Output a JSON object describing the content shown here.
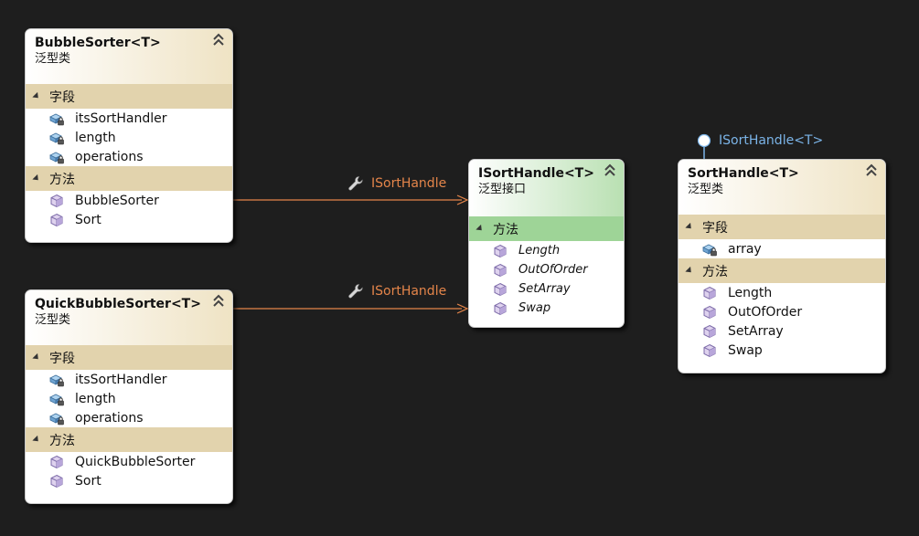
{
  "classes": {
    "bubble": {
      "title": "BubbleSorter<T>",
      "kind": "泛型类",
      "fields_label": "字段",
      "fields": [
        "itsSortHandler",
        "length",
        "operations"
      ],
      "methods_label": "方法",
      "methods": [
        "BubbleSorter",
        "Sort"
      ]
    },
    "quick": {
      "title": "QuickBubbleSorter<T>",
      "kind": "泛型类",
      "fields_label": "字段",
      "fields": [
        "itsSortHandler",
        "length",
        "operations"
      ],
      "methods_label": "方法",
      "methods": [
        "QuickBubbleSorter",
        "Sort"
      ]
    },
    "iface": {
      "title": "ISortHandle<T>",
      "kind": "泛型接口",
      "methods_label": "方法",
      "methods": [
        "Length",
        "OutOfOrder",
        "SetArray",
        "Swap"
      ]
    },
    "sorthandle": {
      "title": "SortHandle<T>",
      "kind": "泛型类",
      "fields_label": "字段",
      "fields": [
        "array"
      ],
      "methods_label": "方法",
      "methods": [
        "Length",
        "OutOfOrder",
        "SetArray",
        "Swap"
      ]
    }
  },
  "associations": {
    "bubble_to_iface": "ISortHandle",
    "quick_to_iface": "ISortHandle"
  },
  "lollipop": {
    "label": "ISortHandle<T>"
  },
  "colors": {
    "background": "#1e1e1e",
    "connector": "#e4854a",
    "lollipop": "#7bb4e8",
    "class_section": "#e2d3ad",
    "interface_section": "#9ed497"
  },
  "icons": {
    "field": "field-lock-icon",
    "method": "method-cube-icon",
    "association": "wrench-icon",
    "collapse": "double-chevron-up-icon",
    "expand_section": "triangle-expand-icon"
  }
}
